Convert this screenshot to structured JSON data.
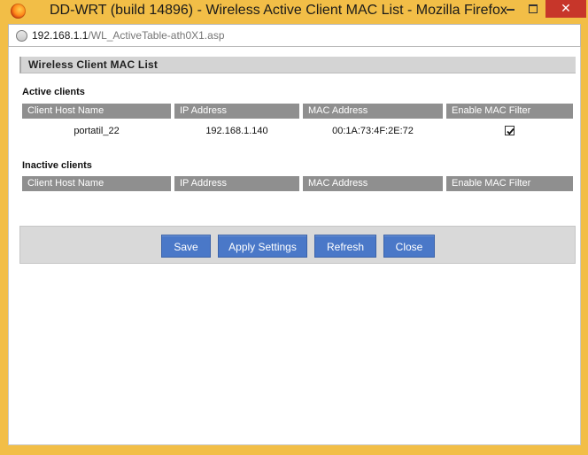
{
  "window": {
    "title": "DD-WRT (build 14896) - Wireless Active Client MAC List - Mozilla Firefox",
    "close_glyph": "✕"
  },
  "urlbar": {
    "host": "192.168.1.1",
    "path": "/WL_ActiveTable-ath0X1.asp"
  },
  "page": {
    "header_title": "Wireless Client MAC List",
    "active_title": "Active clients",
    "inactive_title": "Inactive clients",
    "columns": [
      "Client Host Name",
      "IP Address",
      "MAC Address",
      "Enable MAC Filter"
    ],
    "active_rows": [
      {
        "host": "portatil_22",
        "ip": "192.168.1.140",
        "mac": "00:1A:73:4F:2E:72",
        "mac_filter": true
      }
    ],
    "inactive_rows": []
  },
  "buttons": {
    "save": "Save",
    "apply": "Apply Settings",
    "refresh": "Refresh",
    "close": "Close"
  },
  "colors": {
    "window_frame": "#f2be47",
    "close_button": "#c7362a",
    "column_header": "#8f8f8f",
    "button": "#4a78c8"
  }
}
